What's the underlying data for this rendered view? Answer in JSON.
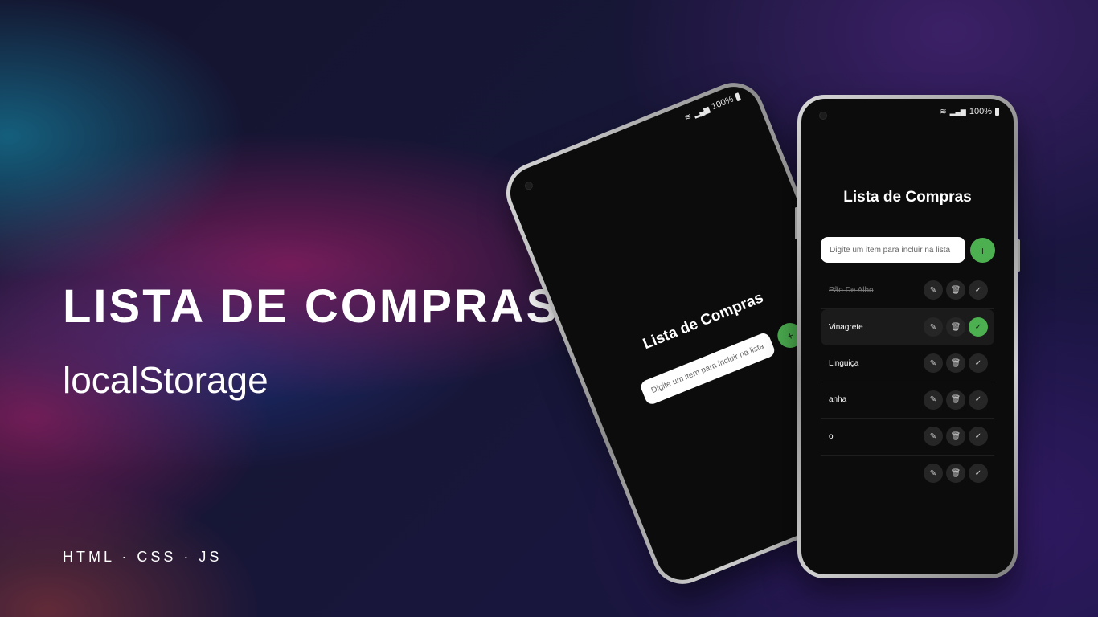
{
  "banner": {
    "headline": "LISTA DE COMPRAS",
    "subtitle": "localStorage",
    "stack": "HTML · CSS · JS"
  },
  "colors": {
    "accent": "#4caf50",
    "screen_bg": "#0c0c0c",
    "text": "#ffffff"
  },
  "phone_left": {
    "status": "100%",
    "app_title": "Lista de Compras",
    "input_placeholder": "Digite um item para incluir na lista",
    "add_label": "+"
  },
  "phone_right": {
    "status": "100%",
    "app_title": "Lista de Compras",
    "input_placeholder": "Digite um item para incluir na lista",
    "add_label": "+",
    "items": [
      {
        "name": "Pão De Alho",
        "done": true
      },
      {
        "name": "Vinagrete",
        "done": false,
        "checked": true
      },
      {
        "name": "Linguiça",
        "done": false
      },
      {
        "name": "anha",
        "done": false
      },
      {
        "name": "o",
        "done": false
      },
      {
        "name": "",
        "done": false
      }
    ],
    "icons": [
      "edit-icon",
      "trash-icon",
      "check-icon"
    ]
  }
}
